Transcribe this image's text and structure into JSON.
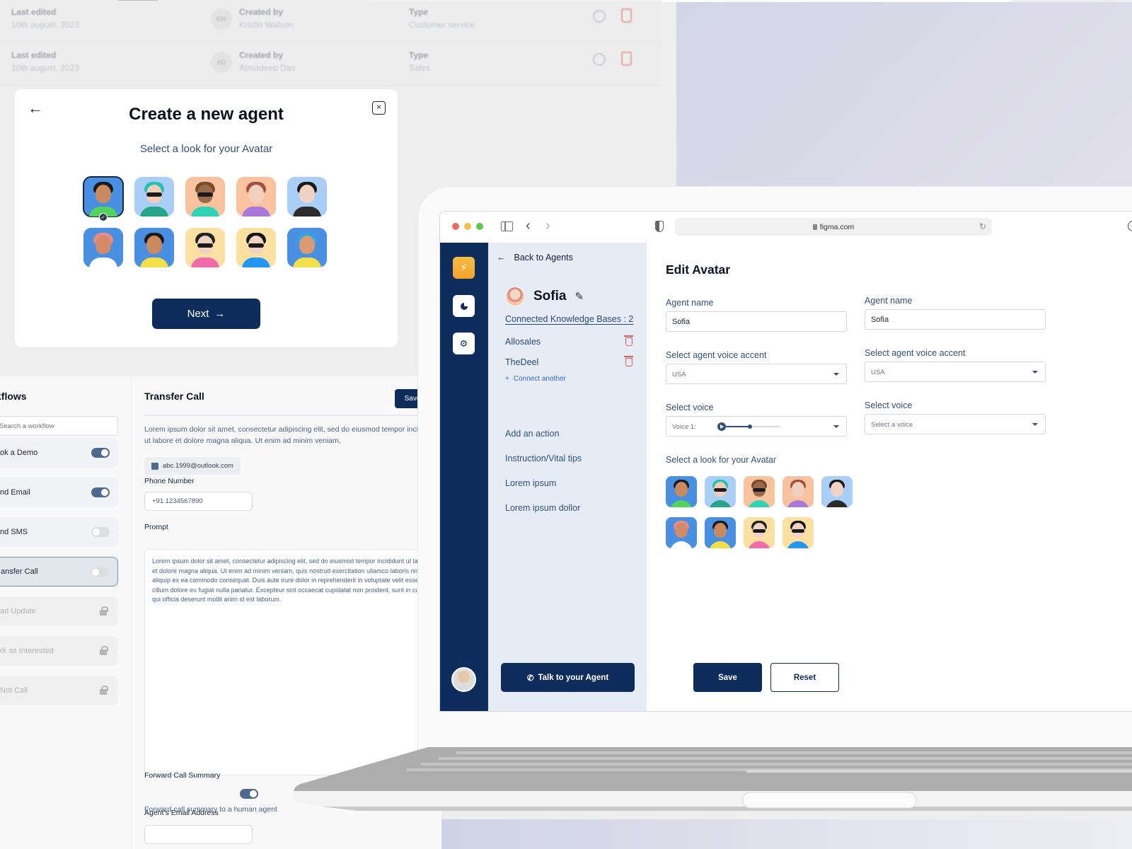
{
  "background_list": {
    "rows": [
      {
        "last_edited_label": "Last edited",
        "last_edited": "10th august, 2023",
        "initials": "KW",
        "created_by_label": "Created by",
        "created_by": "Kristin Watson",
        "type_label": "Type",
        "type": "Customer service"
      },
      {
        "last_edited_label": "Last edited",
        "last_edited": "10th august, 2023",
        "initials": "AD",
        "created_by_label": "Created by",
        "created_by": "Atmadeep Das",
        "type_label": "Type",
        "type": "Sales"
      }
    ]
  },
  "create_modal": {
    "title": "Create a new agent",
    "subtitle": "Select a look for your Avatar",
    "next_label": "Next",
    "close_glyph": "×",
    "back_glyph": "←",
    "selected_index": 0,
    "avatar_count": 10
  },
  "avatars": [
    {
      "name": "avatar-curly-green-hoodie",
      "bg": "#4a90e2",
      "skin": "#c98a5f",
      "hair": "#1b1b1b",
      "outfit": "#52d45c",
      "glasses": false
    },
    {
      "name": "avatar-teal-hair-sunglasses",
      "bg": "#a9cff7",
      "skin": "#f1cdb8",
      "hair": "#22c2b3",
      "outfit": "#26a58a",
      "glasses": true
    },
    {
      "name": "avatar-cap-glasses",
      "bg": "#f9c3a0",
      "skin": "#9a6b4b",
      "hair": "#7a4a2a",
      "outfit": "#2fd3b6",
      "glasses": true
    },
    {
      "name": "avatar-redhead-glasses",
      "bg": "#f9c3a0",
      "skin": "#f2d0c0",
      "hair": "#a0503d",
      "outfit": "#a879d9",
      "glasses": false
    },
    {
      "name": "avatar-black-hair-hoodie",
      "bg": "#a9cff7",
      "skin": "#f1d3c6",
      "hair": "#1a1a1a",
      "outfit": "#2b2b2b",
      "glasses": false
    },
    {
      "name": "avatar-pink-curls",
      "bg": "#4a90e2",
      "skin": "#d38a66",
      "hair": "#e88a8a",
      "outfit": "#ffffff",
      "glasses": false
    },
    {
      "name": "avatar-long-dark-hair",
      "bg": "#4a90e2",
      "skin": "#c98a5f",
      "hair": "#1e1a18",
      "outfit": "#f3e048",
      "glasses": false
    },
    {
      "name": "avatar-bun-sunglasses",
      "bg": "#fbe0a1",
      "skin": "#f1d3c6",
      "hair": "#222222",
      "outfit": "#f06ba8",
      "glasses": true
    },
    {
      "name": "avatar-sunglasses-blue-shirt",
      "bg": "#fbe0a1",
      "skin": "#f1d3c6",
      "hair": "#141414",
      "outfit": "#2196f3",
      "glasses": true
    },
    {
      "name": "avatar-blue-bangs",
      "bg": "#4a90e2",
      "skin": "#d89a6e",
      "hair": "#2fa4e8",
      "outfit": "#f3e048",
      "glasses": false
    }
  ],
  "workflows": {
    "title": "kflows",
    "search_placeholder": "Search a workflow",
    "items": [
      {
        "label": "ok a Demo",
        "state": "on"
      },
      {
        "label": "nd Email",
        "state": "on"
      },
      {
        "label": "nd SMS",
        "state": "off"
      },
      {
        "label": "ansfer Call",
        "state": "off",
        "active": true
      },
      {
        "label": "ad Update",
        "state": "locked"
      },
      {
        "label": "rk as Interested",
        "state": "locked"
      },
      {
        "label": "Not Call",
        "state": "locked"
      }
    ]
  },
  "transfer_call": {
    "title": "Transfer Call",
    "save_label": "Save",
    "description": "Lorem ipsum dolor sit amet, consectetur adipiscing elit, sed do eiusmod tempor incididunt ut labore et dolore magna aliqua. Ut enim ad minim veniam,",
    "email_chip": "abc.1999@outlook.com",
    "phone_label": "Phone Number",
    "phone_value": "+91 1234567890",
    "prompt_label": "Prompt",
    "prompt_value": "Lorem ipsum dolor sit amet, consectetur adipiscing elit, sed do eiusmod tempor incididunt ut labore et dolore magna aliqua. Ut enim ad minim veniam, quis nostrud exercitation ullamco laboris nisi ut aliquip ex ea commodo consequat. Duis aute irure dolor in reprehenderit in voluptate velit esse cillum dolore eu fugiat nulla pariatur. Excepteur sint occaecat cupidatat non proident, sunt in culpa qui officia deserunt mollit anim id est laborum.",
    "forward_label": "Forward Call Summary",
    "forward_on": true,
    "forward_sub": "Forward call summary to a human agent",
    "agent_email_label": "Agent’s Email Address"
  },
  "browser": {
    "url": "figma.com",
    "traffic_lights": [
      "#ec6a5e",
      "#f4bf4f",
      "#61c554"
    ]
  },
  "app": {
    "back_label": "Back to Agents",
    "agent_name": "Sofia",
    "kb_link": "Connected Knowledge Bases : 2",
    "knowledge_bases": [
      "Allosales",
      "TheDeel"
    ],
    "connect_another": "Connect another",
    "nav_links": [
      "Add an action",
      "Instruction/Vital tips",
      "Lorem ipsum",
      "Lorem ipsum dollor"
    ],
    "talk_label": "Talk to your Agent",
    "edit_title": "Edit Avatar",
    "left_form": {
      "name_label": "Agent name",
      "name_value": "Sofia",
      "accent_label": "Select agent voice accent",
      "accent_value": "USA",
      "voice_label": "Select voice",
      "voice_value": "Voice 1:",
      "voice_progress": 0.45
    },
    "right_form": {
      "name_label": "Agent name",
      "name_value": "Sofia",
      "accent_label": "Select agent voice accent",
      "accent_value": "USA",
      "voice_label": "Select voice",
      "voice_placeholder": "Select a voice"
    },
    "look_label": "Select a look for your Avatar",
    "look_avatar_count": 9,
    "save_label": "Save",
    "reset_label": "Reset"
  },
  "colors": {
    "primary": "#0f2d5c",
    "accent_bolt": "#f4b13a",
    "danger": "#e35a5a",
    "link": "#2e6bc4"
  }
}
